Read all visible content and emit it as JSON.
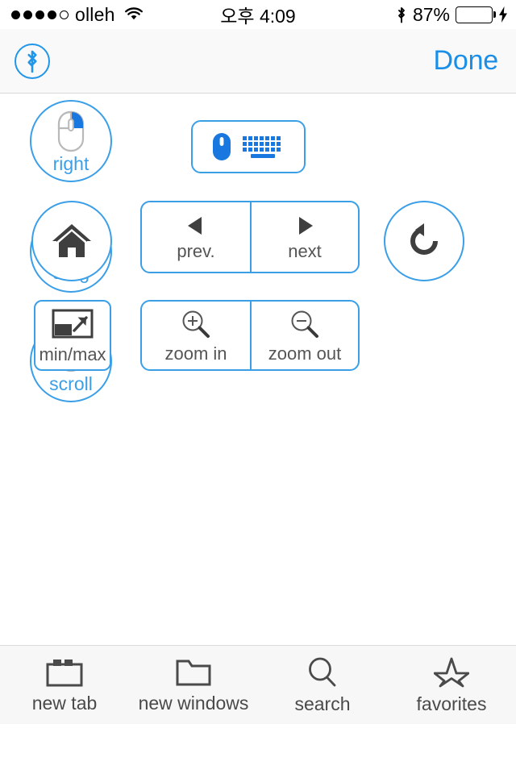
{
  "status_bar": {
    "signal_dots_filled": 4,
    "signal_dots_total": 5,
    "carrier": "olleh",
    "wifi_icon": "wifi-icon",
    "time": "오후 4:09",
    "bluetooth_icon": "bluetooth-icon",
    "battery_percent": "87%",
    "battery_level": 87,
    "battery_color": "#4CD964",
    "charging_icon": "lightning-bolt-icon"
  },
  "nav_bar": {
    "bluetooth_icon": "bluetooth-icon",
    "done_label": "Done"
  },
  "theme": {
    "accent": "#3b9fe8",
    "accent_link": "#1b8fe8",
    "icon_dark": "#444444",
    "label_gray": "#555555",
    "background": "#ffffff",
    "bar_background": "#f7f7f7"
  },
  "mouse_buttons": [
    {
      "id": "right",
      "label": "right",
      "icon": "mouse-right-click-icon"
    },
    {
      "id": "drag",
      "label": "drag",
      "icon": "folder-drag-icon"
    },
    {
      "id": "scroll",
      "label": "scroll",
      "icon": "mouse-scroll-icon"
    }
  ],
  "keyboard_button": {
    "label": "",
    "mouse_icon": "mouse-icon",
    "keyboard_icon": "keyboard-icon"
  },
  "nav_row": {
    "home": {
      "label": "",
      "icon": "home-icon"
    },
    "prev": {
      "label": "prev.",
      "icon": "triangle-left-icon"
    },
    "next": {
      "label": "next",
      "icon": "triangle-right-icon"
    },
    "refresh": {
      "label": "",
      "icon": "refresh-counterclockwise-icon"
    }
  },
  "zoom_row": {
    "minmax": {
      "label": "min/max",
      "icon": "minimize-maximize-icon"
    },
    "zoom_in": {
      "label": "zoom in",
      "icon": "magnifier-plus-icon"
    },
    "zoom_out": {
      "label": "zoom out",
      "icon": "magnifier-minus-icon"
    }
  },
  "tab_bar": [
    {
      "id": "new-tab",
      "label": "new tab",
      "icon": "tabs-icon"
    },
    {
      "id": "new-windows",
      "label": "new windows",
      "icon": "folder-icon"
    },
    {
      "id": "search",
      "label": "search",
      "icon": "search-icon"
    },
    {
      "id": "favorites",
      "label": "favorites",
      "icon": "star-icon"
    }
  ]
}
